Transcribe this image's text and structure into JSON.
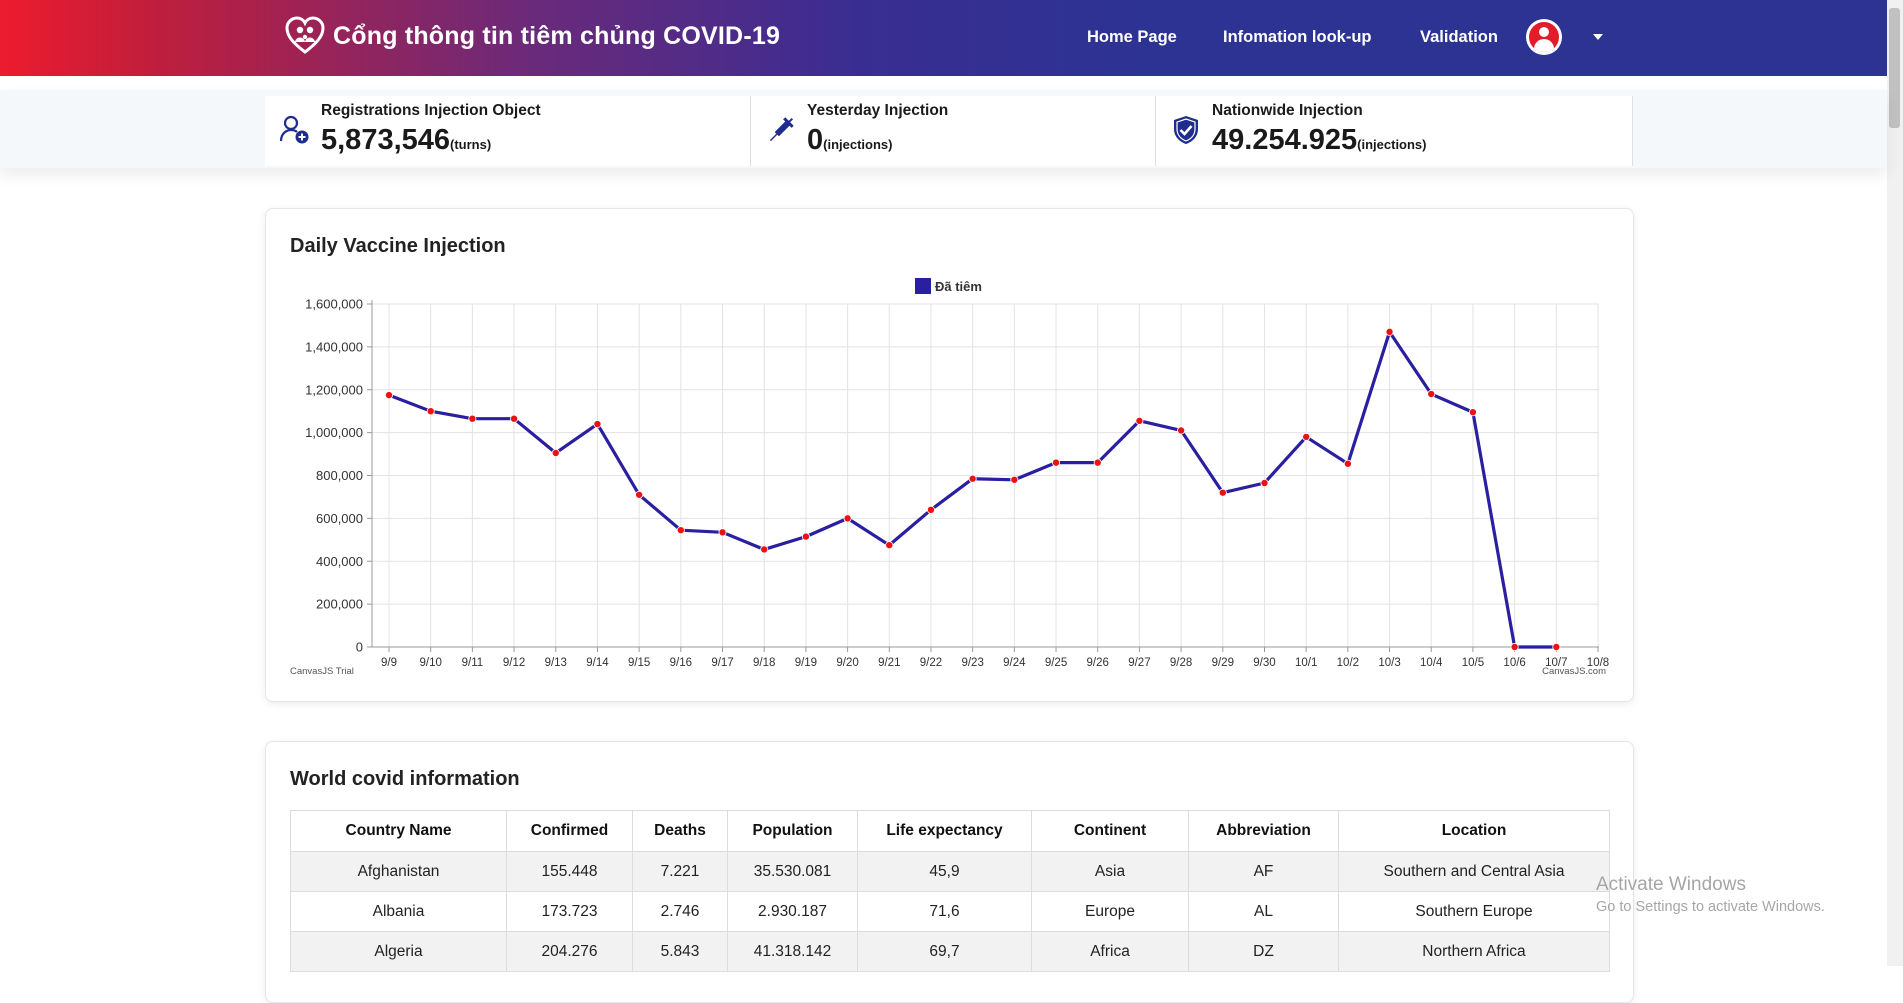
{
  "header": {
    "brand": "Cổng thông tin tiêm chủng COVID-19",
    "logo_icon": "heart-family-logo-icon",
    "nav": [
      {
        "label": "Home Page"
      },
      {
        "label": "Infomation look-up"
      },
      {
        "label": "Validation"
      }
    ],
    "avatar_icon": "user-avatar-icon",
    "dropdown_icon": "caret-down-icon",
    "colors": {
      "gradient_start": "#ed1b2f",
      "gradient_end": "#2d3393"
    }
  },
  "stats": [
    {
      "title": "Registrations Injection Object",
      "value": "5,873,546",
      "unit": "(turns)",
      "icon": "user-add-icon"
    },
    {
      "title": "Yesterday Injection",
      "value": "0",
      "unit": "(injections)",
      "icon": "syringe-icon"
    },
    {
      "title": "Nationwide Injection",
      "value": "49.254.925",
      "unit": "(injections)",
      "icon": "shield-check-icon"
    }
  ],
  "chart_card": {
    "title": "Daily Vaccine Injection",
    "trial_label": "CanvasJS Trial",
    "credit": "CanvasJS.com"
  },
  "chart_data": {
    "type": "line",
    "legend": "Đã tiêm",
    "legend_position": "top-center",
    "color": "#2a1fa0",
    "marker_color": "#ee1111",
    "grid": true,
    "ylim": [
      0,
      1600000
    ],
    "y_ticks": [
      "0",
      "200,000",
      "400,000",
      "600,000",
      "800,000",
      "1,000,000",
      "1,200,000",
      "1,400,000",
      "1,600,000"
    ],
    "categories": [
      "9/9",
      "9/10",
      "9/11",
      "9/12",
      "9/13",
      "9/14",
      "9/15",
      "9/16",
      "9/17",
      "9/18",
      "9/19",
      "9/20",
      "9/21",
      "9/22",
      "9/23",
      "9/24",
      "9/25",
      "9/26",
      "9/27",
      "9/28",
      "9/29",
      "9/30",
      "10/1",
      "10/2",
      "10/3",
      "10/4",
      "10/5",
      "10/6",
      "10/7",
      "10/8"
    ],
    "values": [
      1175000,
      1100000,
      1065000,
      1065000,
      905000,
      1040000,
      710000,
      545000,
      535000,
      455000,
      515000,
      600000,
      475000,
      640000,
      785000,
      780000,
      860000,
      860000,
      1055000,
      1010000,
      720000,
      765000,
      980000,
      855000,
      1470000,
      1180000,
      1095000,
      0,
      0,
      null
    ]
  },
  "table_card": {
    "title": "World covid information",
    "headers": [
      "Country Name",
      "Confirmed",
      "Deaths",
      "Population",
      "Life expectancy",
      "Continent",
      "Abbreviation",
      "Location"
    ],
    "rows": [
      [
        "Afghanistan",
        "155.448",
        "7.221",
        "35.530.081",
        "45,9",
        "Asia",
        "AF",
        "Southern and Central Asia"
      ],
      [
        "Albania",
        "173.723",
        "2.746",
        "2.930.187",
        "71,6",
        "Europe",
        "AL",
        "Southern Europe"
      ],
      [
        "Algeria",
        "204.276",
        "5.843",
        "41.318.142",
        "69,7",
        "Africa",
        "DZ",
        "Northern Africa"
      ]
    ]
  },
  "os_watermark": {
    "line1": "Activate Windows",
    "line2": "Go to Settings to activate Windows."
  }
}
